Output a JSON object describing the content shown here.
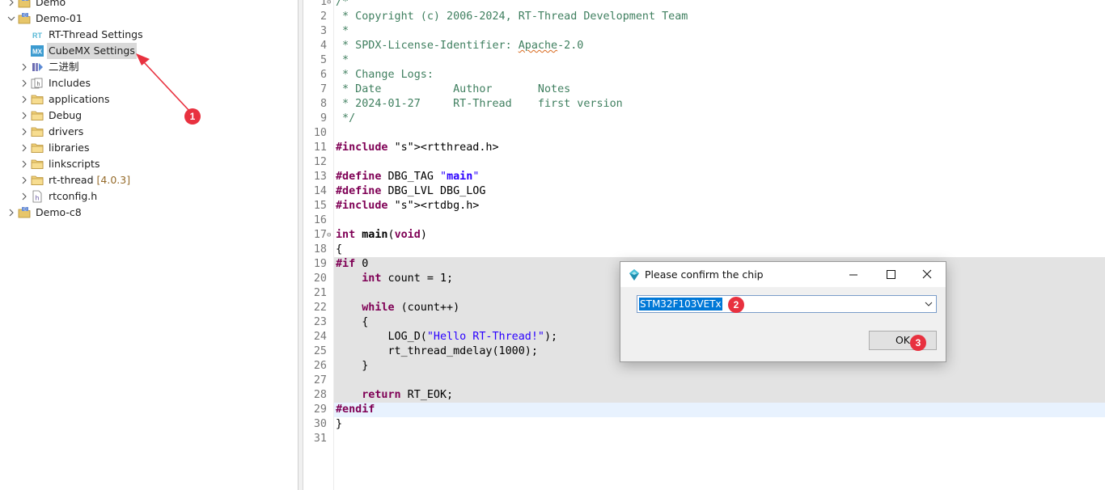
{
  "explorer": {
    "items": [
      {
        "label": "Demo",
        "level": 0,
        "expanded": false,
        "icon": "project-icon"
      },
      {
        "label": "Demo-01",
        "level": 0,
        "expanded": true,
        "icon": "project-icon"
      },
      {
        "label": "RT-Thread Settings",
        "level": 1,
        "icon": "rt-settings-icon"
      },
      {
        "label": "CubeMX Settings",
        "level": 1,
        "icon": "cubemx-icon",
        "selected": true
      },
      {
        "label": "二进制",
        "level": 1,
        "expanded": false,
        "icon": "binaries-icon"
      },
      {
        "label": "Includes",
        "level": 1,
        "expanded": false,
        "icon": "includes-icon"
      },
      {
        "label": "applications",
        "level": 1,
        "expanded": false,
        "icon": "folder-icon"
      },
      {
        "label": "Debug",
        "level": 1,
        "expanded": false,
        "icon": "folder-icon"
      },
      {
        "label": "drivers",
        "level": 1,
        "expanded": false,
        "icon": "folder-icon"
      },
      {
        "label": "libraries",
        "level": 1,
        "expanded": false,
        "icon": "folder-icon"
      },
      {
        "label": "linkscripts",
        "level": 1,
        "expanded": false,
        "icon": "folder-icon"
      },
      {
        "label": "rt-thread",
        "version": "[4.0.3]",
        "level": 1,
        "expanded": false,
        "icon": "folder-icon"
      },
      {
        "label": "rtconfig.h",
        "level": 1,
        "expanded": false,
        "icon": "header-file-icon"
      },
      {
        "label": "Demo-c8",
        "level": 0,
        "expanded": false,
        "icon": "project-icon"
      }
    ]
  },
  "editor": {
    "lines": [
      {
        "n": "1",
        "text": "/*"
      },
      {
        "n": "2",
        "text": " * Copyright (c) 2006-2024, RT-Thread Development Team"
      },
      {
        "n": "3",
        "text": " *"
      },
      {
        "n": "4",
        "text": " * SPDX-License-Identifier: Apache-2.0"
      },
      {
        "n": "5",
        "text": " *"
      },
      {
        "n": "6",
        "text": " * Change Logs:"
      },
      {
        "n": "7",
        "text": " * Date           Author       Notes"
      },
      {
        "n": "8",
        "text": " * 2024-01-27     RT-Thread    first version"
      },
      {
        "n": "9",
        "text": " */"
      },
      {
        "n": "10",
        "text": ""
      },
      {
        "n": "11",
        "text": "#include <rtthread.h>"
      },
      {
        "n": "12",
        "text": ""
      },
      {
        "n": "13",
        "text": "#define DBG_TAG \"main\""
      },
      {
        "n": "14",
        "text": "#define DBG_LVL DBG_LOG"
      },
      {
        "n": "15",
        "text": "#include <rtdbg.h>"
      },
      {
        "n": "16",
        "text": ""
      },
      {
        "n": "17",
        "text": "int main(void)"
      },
      {
        "n": "18",
        "text": "{"
      },
      {
        "n": "19",
        "text": "#if 0"
      },
      {
        "n": "20",
        "text": "    int count = 1;"
      },
      {
        "n": "21",
        "text": ""
      },
      {
        "n": "22",
        "text": "    while (count++)"
      },
      {
        "n": "23",
        "text": "    {"
      },
      {
        "n": "24",
        "text": "        LOG_D(\"Hello RT-Thread!\");"
      },
      {
        "n": "25",
        "text": "        rt_thread_mdelay(1000);"
      },
      {
        "n": "26",
        "text": "    }"
      },
      {
        "n": "27",
        "text": ""
      },
      {
        "n": "28",
        "text": "    return RT_EOK;"
      },
      {
        "n": "29",
        "text": "#endif"
      },
      {
        "n": "30",
        "text": "}"
      },
      {
        "n": "31",
        "text": ""
      }
    ]
  },
  "dialog": {
    "title": "Please confirm the chip",
    "chip_value": "STM32F103VETx",
    "ok_label": "OK"
  },
  "annotations": {
    "badge1": "1",
    "badge2": "2",
    "badge3": "3",
    "color": "#e8313f"
  }
}
